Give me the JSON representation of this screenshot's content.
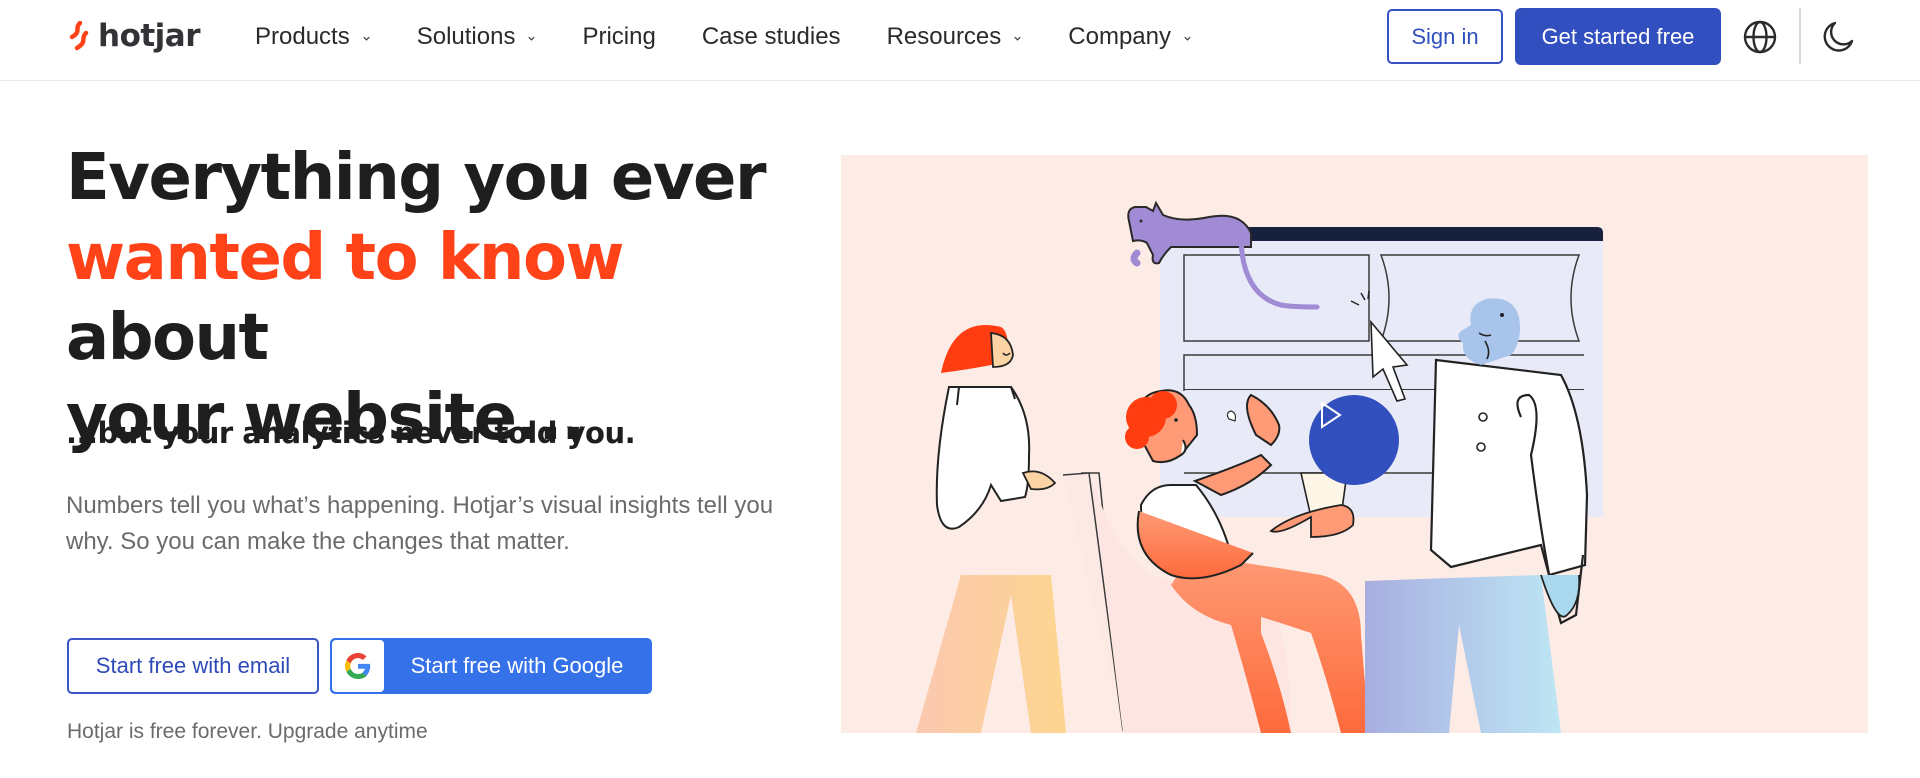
{
  "brand": {
    "name": "hotjar",
    "accent_color": "#ff4217",
    "primary_color": "#324fbf"
  },
  "nav": {
    "items": [
      {
        "label": "Products",
        "has_dropdown": true
      },
      {
        "label": "Solutions",
        "has_dropdown": true
      },
      {
        "label": "Pricing",
        "has_dropdown": false
      },
      {
        "label": "Case studies",
        "has_dropdown": false
      },
      {
        "label": "Resources",
        "has_dropdown": true
      },
      {
        "label": "Company",
        "has_dropdown": true
      }
    ],
    "sign_in_label": "Sign in",
    "get_started_label": "Get started free",
    "language_icon": "globe-icon",
    "theme_icon": "moon-icon"
  },
  "hero": {
    "title_line1": "Everything you ever",
    "title_accent": "wanted to know",
    "title_after_accent": " about",
    "title_line3": "your website...",
    "subtitle": "...but your analytics never told you.",
    "description": "Numbers tell you what’s happening. Hotjar’s visual insights tell you why. So you can make the changes that matter.",
    "email_button_label": "Start free with email",
    "google_button_label": "Start free with Google",
    "free_note": "Hotjar is free forever. Upgrade anytime"
  },
  "illustration": {
    "description": "Illustration of people watching a website recording with a cat on top of the screen",
    "play_icon": "play-icon"
  }
}
